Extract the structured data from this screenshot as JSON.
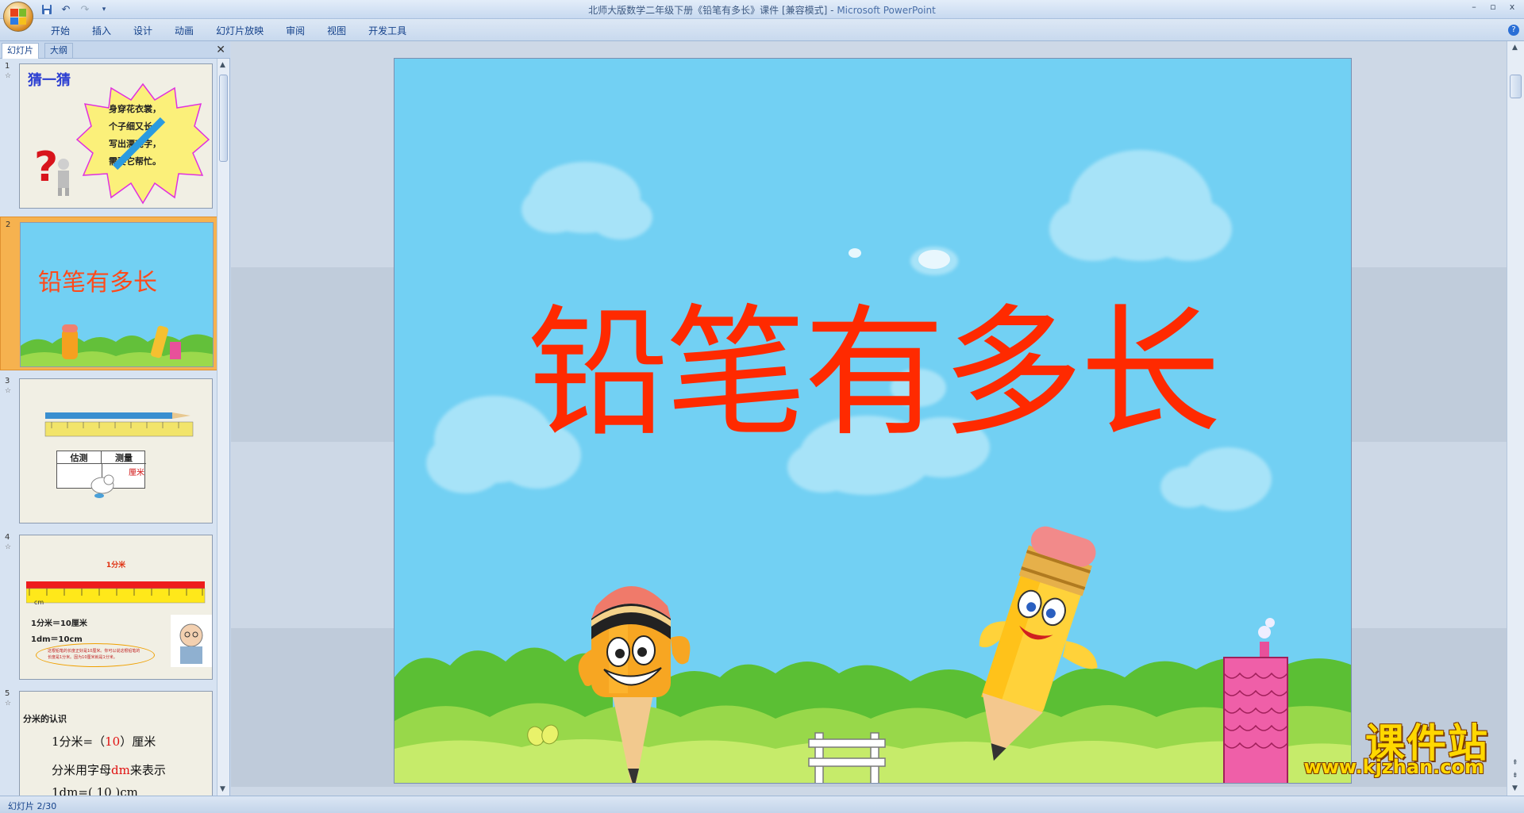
{
  "window": {
    "title_doc": "北师大版数学二年级下册《铅笔有多长》课件 [兼容模式]",
    "title_sep": " - ",
    "title_app": "Microsoft PowerPoint",
    "min": "–",
    "restore": "▫",
    "close": "x"
  },
  "ribbon": {
    "tabs": [
      "开始",
      "插入",
      "设计",
      "动画",
      "幻灯片放映",
      "审阅",
      "视图",
      "开发工具"
    ],
    "help": "?"
  },
  "left_pane": {
    "tab_slides": "幻灯片",
    "tab_outline": "大纲",
    "close": "✕"
  },
  "thumbnails": [
    {
      "num": "1",
      "title": "猜一猜",
      "lines": [
        "身穿花衣裳，",
        "个子细又长。",
        "写出漂亮字，",
        "需要它帮忙。"
      ]
    },
    {
      "num": "2",
      "title": "铅笔有多长"
    },
    {
      "num": "3",
      "h1": "估测",
      "h2": "测量",
      "unit": "厘米"
    },
    {
      "num": "4",
      "title": "1分米",
      "l1": "1分米＝10厘米",
      "l2": "1dm＝10cm",
      "ruler_unit": "cm",
      "note_a": "这根铅笔的长度正好是10厘米。你可以说这根铅笔的",
      "note_b": "长度是1分米。因为10厘米就是1分米。"
    },
    {
      "num": "5",
      "title": "分米的认识",
      "l1_pre": "1分米=（",
      "l1_val": "10",
      "l1_post": "）厘米",
      "l2_pre": "分米用字母",
      "l2_val": "dm",
      "l2_post": "来表示",
      "l3": "1dm=( 10 )cm"
    }
  ],
  "slide": {
    "title": "铅笔有多长"
  },
  "status": {
    "text": "幻灯片 2/30"
  },
  "watermark": {
    "title": "课件站",
    "url": "www.kjzhan.com"
  },
  "colors": {
    "slide_sky": "#72d0f3",
    "title_red": "#ff2a00",
    "selected_thumb": "#f6b24f"
  }
}
